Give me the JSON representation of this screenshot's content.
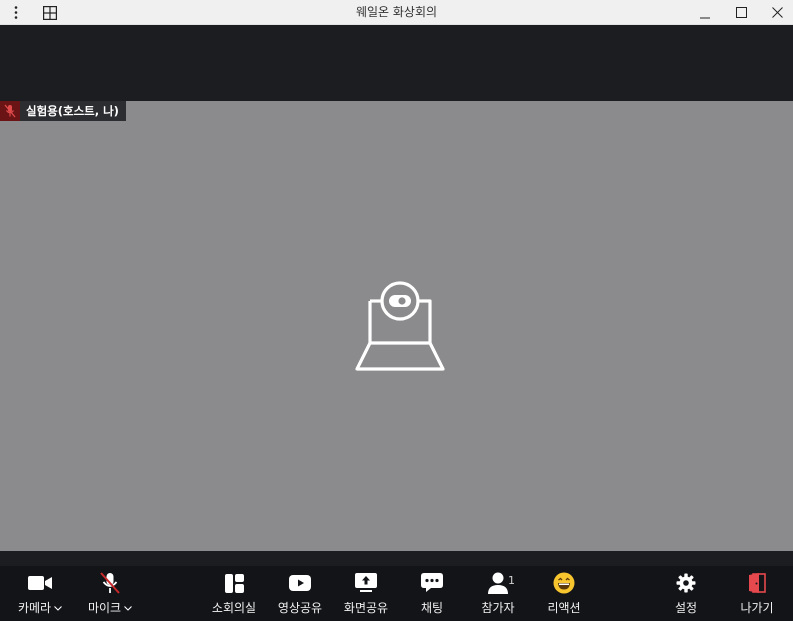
{
  "window": {
    "title": "웨일온 화상회의"
  },
  "participant": {
    "name": "실험용(호스트, 나)"
  },
  "toolbar": {
    "camera_label": "카메라",
    "mic_label": "마이크",
    "breakout_label": "소회의실",
    "video_share_label": "영상공유",
    "screen_share_label": "화면공유",
    "chat_label": "채팅",
    "participants_label": "참가자",
    "participants_count": "1",
    "reaction_label": "리액션",
    "settings_label": "설정",
    "leave_label": "나가기"
  },
  "colors": {
    "titlebar": "#f0f0f0",
    "dark_bg": "#1c1d21",
    "toolbar_bg": "#131418",
    "video_bg": "#8b8b8d",
    "muted_red": "#c82829",
    "leave_red": "#e5484d",
    "reaction_yellow": "#f7c52e"
  },
  "icons": {
    "menu": "vertical-dots-icon",
    "layout": "grid-layout-icon",
    "minimize": "minimize-icon",
    "maximize": "maximize-icon",
    "close": "close-icon",
    "camera": "video-camera-icon",
    "mic": "microphone-muted-icon",
    "breakout": "breakout-rooms-icon",
    "video_share": "play-icon",
    "screen_share": "screen-share-icon",
    "chat": "chat-icon",
    "participants": "person-icon",
    "reaction": "laughing-emoji-icon",
    "settings": "gear-icon",
    "leave": "exit-door-icon"
  }
}
